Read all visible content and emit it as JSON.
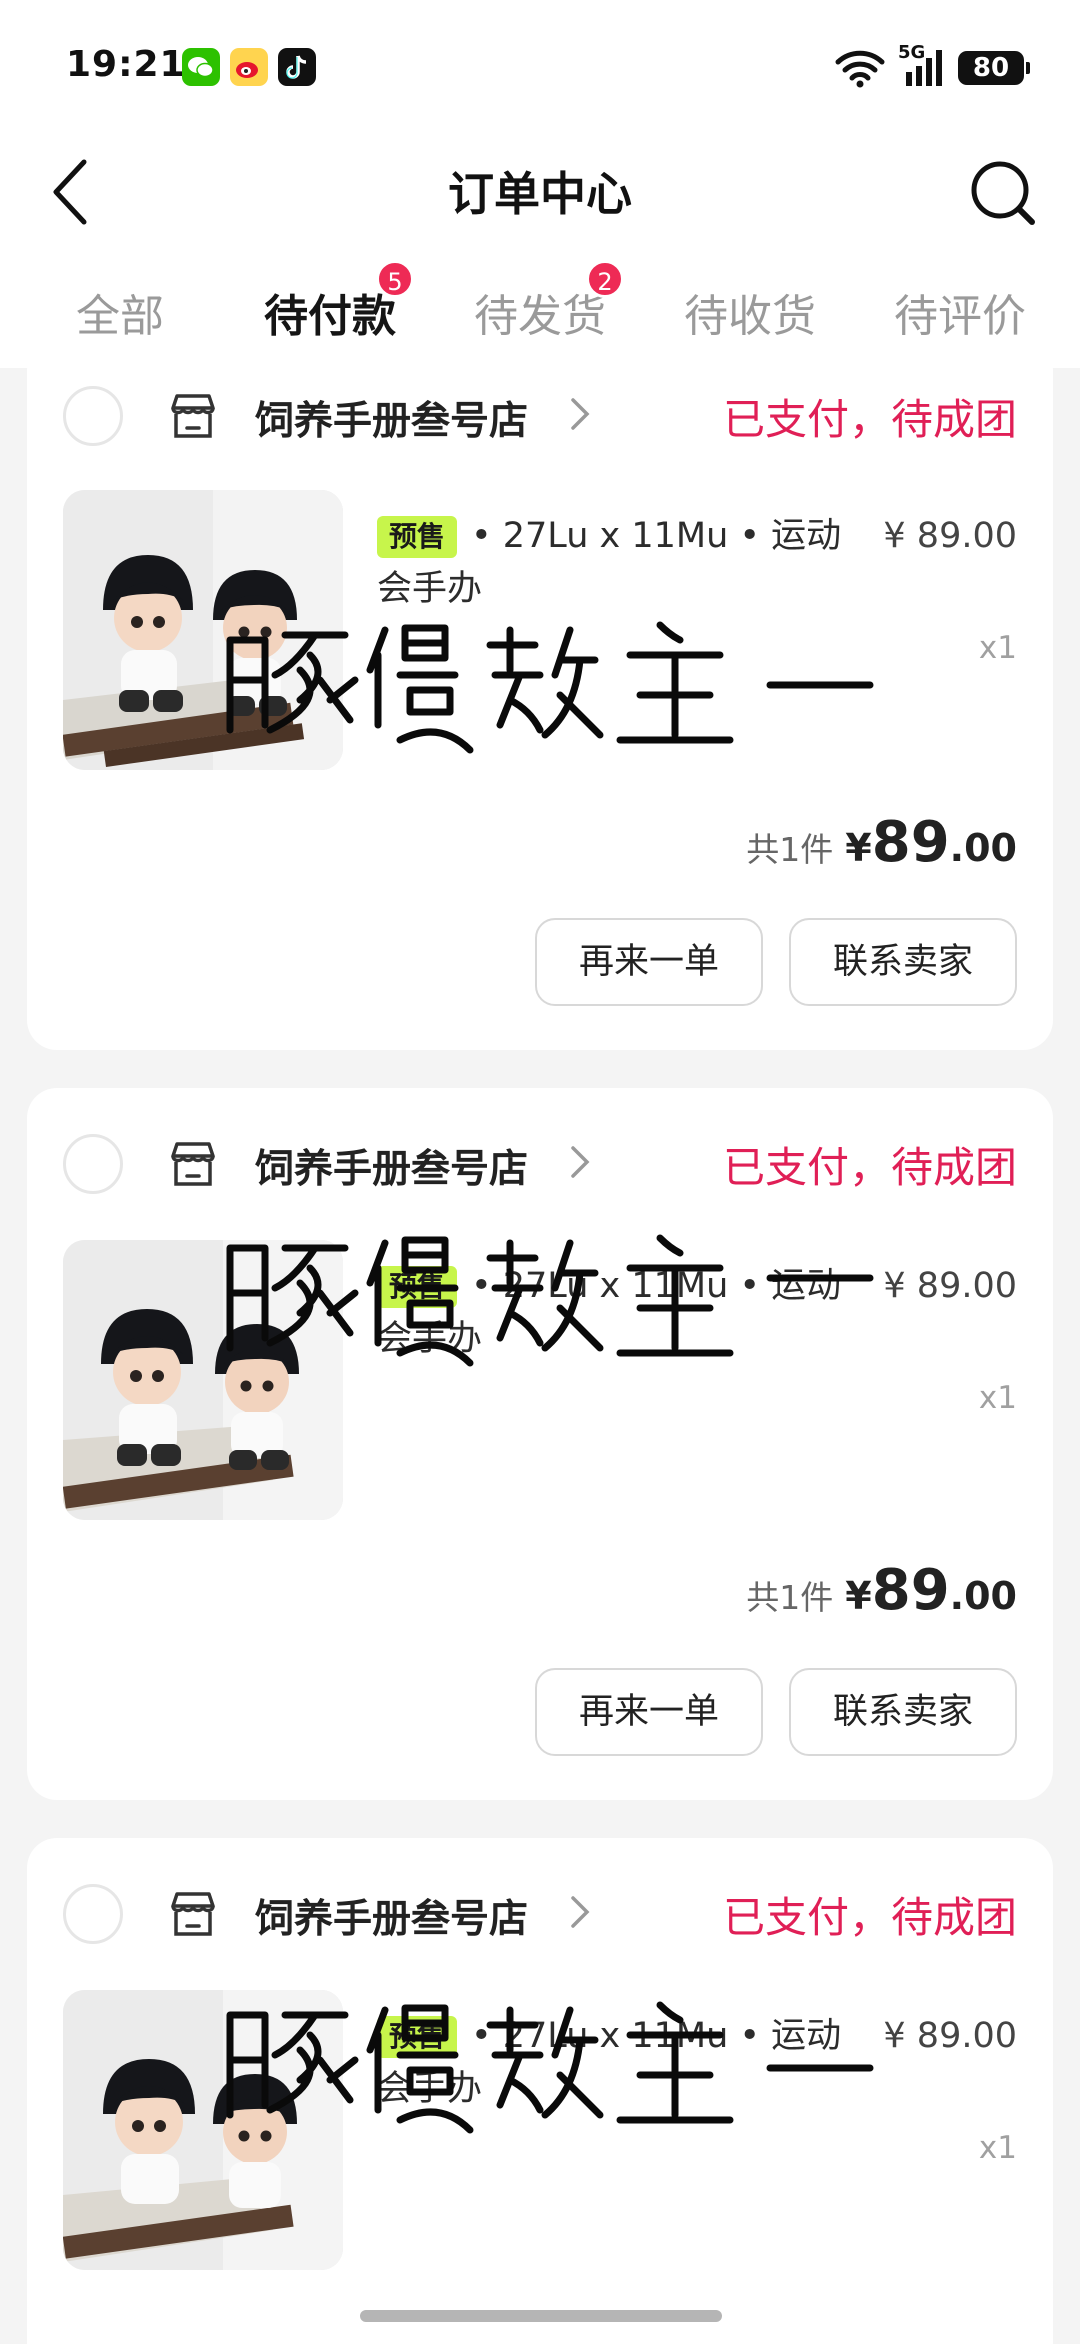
{
  "status_bar": {
    "time": "19:21",
    "apps": [
      "wechat-icon",
      "weibo-icon",
      "douyin-icon"
    ],
    "network": "5G",
    "battery": "80"
  },
  "nav": {
    "title": "订单中心",
    "back_icon": "back-chevron-icon",
    "search_icon": "search-icon"
  },
  "tabs": [
    {
      "label": "全部",
      "badge": ""
    },
    {
      "label": "待付款",
      "badge": "5",
      "active": true
    },
    {
      "label": "待发货",
      "badge": "2"
    },
    {
      "label": "待收货",
      "badge": ""
    },
    {
      "label": "待评价",
      "badge": ""
    }
  ],
  "orders": [
    {
      "shop": "饲养手册叁号店",
      "status": "已支付，待成团",
      "tag": "预售",
      "title": "• 27Lu x 11Mu • 运动会手办",
      "price": "¥ 89.00",
      "qty": "x1",
      "count": "共1件",
      "total_currency": "¥",
      "total_int": "89",
      "total_dec": ".00",
      "btn_again": "再来一单",
      "btn_contact": "联系卖家"
    },
    {
      "shop": "饲养手册叁号店",
      "status": "已支付，待成团",
      "tag": "预售",
      "title": "• 27Lu x 11Mu • 运动会手办",
      "price": "¥ 89.00",
      "qty": "x1",
      "count": "共1件",
      "total_currency": "¥",
      "total_int": "89",
      "total_dec": ".00",
      "btn_again": "再来一单",
      "btn_contact": "联系卖家"
    },
    {
      "shop": "饲养手册叁号店",
      "status": "已支付，待成团",
      "tag": "预售",
      "title": "• 27Lu x 11Mu • 运动会手办",
      "price": "¥ 89.00",
      "qty": "x1"
    }
  ],
  "watermark": "豚馒教主-",
  "colors": {
    "accent": "#ee2a55",
    "status_text": "#e01f56",
    "tag_bg": "#c7f54b",
    "page_bg": "#f4f4f4"
  }
}
